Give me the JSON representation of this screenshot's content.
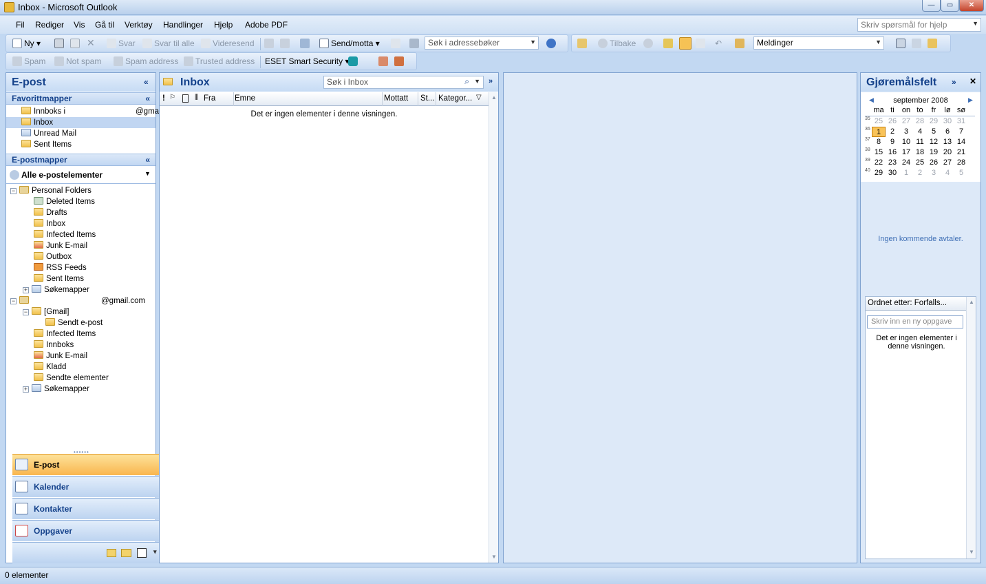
{
  "window": {
    "title": "Inbox - Microsoft Outlook"
  },
  "menu": [
    "Fil",
    "Rediger",
    "Vis",
    "Gå til",
    "Verktøy",
    "Handlinger",
    "Hjelp",
    "Adobe PDF"
  ],
  "help_placeholder": "Skriv spørsmål for hjelp",
  "toolbar1": {
    "new": "Ny",
    "reply": "Svar",
    "reply_all": "Svar til alle",
    "forward": "Videresend",
    "sendrecv": "Send/motta",
    "addr_placeholder": "Søk i adressebøker",
    "back": "Tilbake",
    "view_combo": "Meldinger"
  },
  "toolbar2": {
    "spam": "Spam",
    "notspam": "Not spam",
    "spam_address": "Spam address",
    "trusted": "Trusted address",
    "eset": "ESET Smart Security"
  },
  "nav": {
    "title": "E-post",
    "favorites_header": "Favorittmapper",
    "favorites": [
      {
        "label": "Innboks i",
        "extra": "@gma"
      },
      {
        "label": "Inbox",
        "extra": ""
      },
      {
        "label": "Unread Mail",
        "extra": ""
      },
      {
        "label": "Sent Items",
        "extra": ""
      }
    ],
    "mail_header": "E-postmapper",
    "all_items": "Alle e-postelementer",
    "tree": [
      {
        "label": "Personal Folders"
      },
      {
        "label": "Deleted Items"
      },
      {
        "label": "Drafts"
      },
      {
        "label": "Inbox"
      },
      {
        "label": "Infected Items"
      },
      {
        "label": "Junk E-mail"
      },
      {
        "label": "Outbox"
      },
      {
        "label": "RSS Feeds"
      },
      {
        "label": "Sent Items"
      },
      {
        "label": "Søkemapper"
      },
      {
        "label": "@gmail.com"
      },
      {
        "label": "[Gmail]"
      },
      {
        "label": "Sendt e-post"
      },
      {
        "label": "Infected Items"
      },
      {
        "label": "Innboks"
      },
      {
        "label": "Junk E-mail"
      },
      {
        "label": "Kladd"
      },
      {
        "label": "Sendte elementer"
      },
      {
        "label": "Søkemapper"
      }
    ],
    "buttons": [
      "E-post",
      "Kalender",
      "Kontakter",
      "Oppgaver"
    ]
  },
  "inbox": {
    "title": "Inbox",
    "search_placeholder": "Søk i Inbox",
    "columns": {
      "from": "Fra",
      "subject": "Emne",
      "received": "Mottatt",
      "size": "St...",
      "category": "Kategor..."
    },
    "empty": "Det er ingen elementer i denne visningen."
  },
  "todo": {
    "title": "Gjøremålsfelt",
    "month": "september 2008",
    "days": [
      "ma",
      "ti",
      "on",
      "to",
      "fr",
      "lø",
      "sø"
    ],
    "weeks": [
      {
        "n": "35",
        "d": [
          "25",
          "26",
          "27",
          "28",
          "29",
          "30",
          "31"
        ]
      },
      {
        "n": "36",
        "d": [
          "1",
          "2",
          "3",
          "4",
          "5",
          "6",
          "7"
        ]
      },
      {
        "n": "37",
        "d": [
          "8",
          "9",
          "10",
          "11",
          "12",
          "13",
          "14"
        ]
      },
      {
        "n": "38",
        "d": [
          "15",
          "16",
          "17",
          "18",
          "19",
          "20",
          "21"
        ]
      },
      {
        "n": "39",
        "d": [
          "22",
          "23",
          "24",
          "25",
          "26",
          "27",
          "28"
        ]
      },
      {
        "n": "40",
        "d": [
          "29",
          "30",
          "1",
          "2",
          "3",
          "4",
          "5"
        ]
      }
    ],
    "appointments": "Ingen kommende avtaler.",
    "sort": "Ordnet etter: Forfalls...",
    "task_placeholder": "Skriv inn en ny oppgave",
    "tasks_empty": "Det er ingen elementer i denne visningen."
  },
  "status": {
    "text": "0 elementer"
  }
}
